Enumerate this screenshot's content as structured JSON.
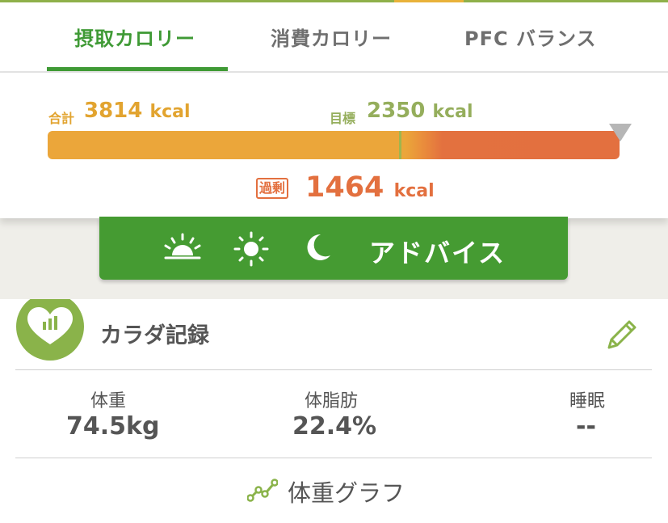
{
  "tabs": [
    {
      "label": "摂取カロリー"
    },
    {
      "label": "消費カロリー"
    },
    {
      "label": "PFC バランス"
    }
  ],
  "calories": {
    "total_label": "合計",
    "total_value": "3814",
    "goal_label": "目標",
    "goal_value": "2350",
    "unit": "kcal",
    "over_label": "過剰",
    "over_value": "1464",
    "progress_fraction": 1.623
  },
  "advice": {
    "label": "アドバイス",
    "icons": [
      "sunrise-icon",
      "sun-icon",
      "moon-icon"
    ]
  },
  "body_record": {
    "title": "カラダ記録",
    "stats": [
      {
        "label": "体重",
        "value": "74.5kg"
      },
      {
        "label": "体脂肪",
        "value": "22.4%"
      },
      {
        "label": "睡眠",
        "value": "--"
      }
    ],
    "graph_label": "体重グラフ"
  },
  "colors": {
    "accent_green": "#3f9a35",
    "intake_orange": "#eba63a",
    "over_red": "#e3703f",
    "goal_green": "#95ae5c",
    "record_icon_green": "#8ab34a"
  }
}
